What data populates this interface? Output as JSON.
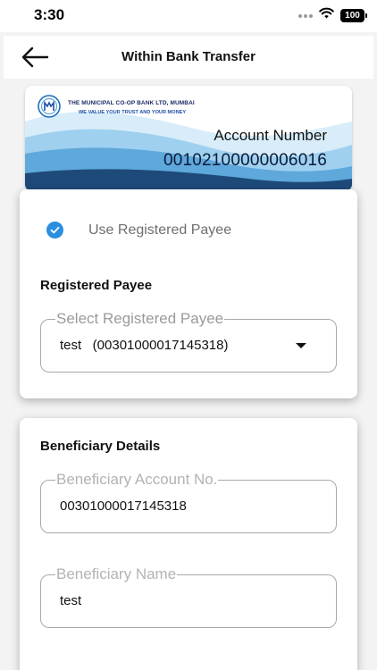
{
  "status_bar": {
    "time": "3:30",
    "battery": "100"
  },
  "header": {
    "title": "Within Bank Transfer"
  },
  "account_card": {
    "bank_name": "THE MUNICIPAL CO-OP BANK LTD, MUMBAI",
    "tagline": "WE VALUE YOUR TRUST AND YOUR MONEY",
    "account_label": "Account Number",
    "account_number": "00102100000006016"
  },
  "payee_panel": {
    "use_registered_label": "Use Registered Payee",
    "use_registered_checked": true,
    "section_title": "Registered Payee",
    "select_label": "Select Registered Payee",
    "select_value": "test   (00301000017145318)"
  },
  "beneficiary_panel": {
    "section_title": "Beneficiary Details",
    "account_label": "Beneficiary Account No.",
    "account_value": "00301000017145318",
    "name_label": "Beneficiary Name",
    "name_value": "test"
  },
  "colors": {
    "accent": "#2b8fe0",
    "wave_dark": "#1e4a7a",
    "wave_light": "#bfe0f5"
  }
}
